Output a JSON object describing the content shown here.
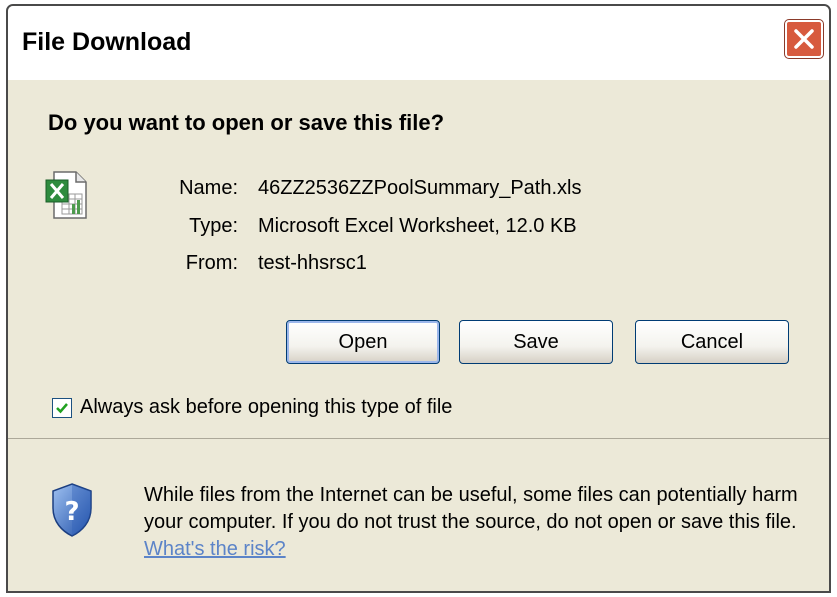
{
  "window": {
    "title": "File Download",
    "close_icon": "close-icon"
  },
  "dialog": {
    "question": "Do you want to open or save this file?",
    "file_icon": "excel-file-icon",
    "file": {
      "name_label": "Name:",
      "name_value": "46ZZ2536ZZPoolSummary_Path.xls",
      "type_label": "Type:",
      "type_value": "Microsoft Excel Worksheet, 12.0 KB",
      "from_label": "From:",
      "from_value": "test-hhsrsc1"
    },
    "buttons": {
      "open": "Open",
      "save": "Save",
      "cancel": "Cancel"
    },
    "checkbox": {
      "label": "Always ask before opening this type of file",
      "checked": true
    },
    "warning": {
      "icon": "security-shield-icon",
      "text": "While files from the Internet can be useful, some files can potentially harm your computer. If you do not trust the source, do not open or save this file.",
      "link": "What's the risk?"
    }
  },
  "colors": {
    "dialog_bg": "#ece9d8",
    "close_red": "#d75a3e",
    "link_blue": "#5c84c8",
    "button_border": "#003c74"
  }
}
